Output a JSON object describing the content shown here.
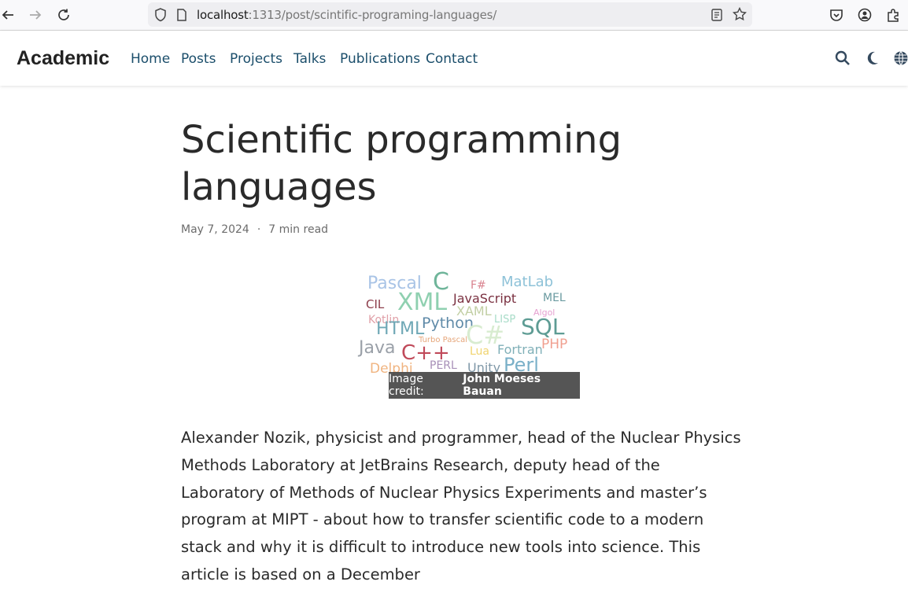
{
  "browser": {
    "url_host": "localhost",
    "url_path": ":1313/post/scintific-programing-languages/"
  },
  "site": {
    "brand": "Academic",
    "menu": [
      "Home",
      "Posts",
      "Projects",
      "Talks",
      "Publications",
      "Contact"
    ]
  },
  "post": {
    "title": "Scientific programming languages",
    "date": "May 7, 2024",
    "separator": "·",
    "read_time": "7 min read",
    "image_credit_prefix": "Image credit:",
    "image_credit_author": "John Moeses Bauan",
    "wordcloud": [
      {
        "text": "Pascal",
        "color": "#a9c4e6"
      },
      {
        "text": "C",
        "color": "#6fb59a"
      },
      {
        "text": "F#",
        "color": "#d9838f"
      },
      {
        "text": "MatLab",
        "color": "#8ec2d8"
      },
      {
        "text": "CIL",
        "color": "#8c3c4a"
      },
      {
        "text": "XML",
        "color": "#8fd0b0"
      },
      {
        "text": "JavaScript",
        "color": "#7a3040"
      },
      {
        "text": "MEL",
        "color": "#6a9aa0"
      },
      {
        "text": "XAML",
        "color": "#c2cfa4"
      },
      {
        "text": "Algol",
        "color": "#e6a0d0"
      },
      {
        "text": "Kotlin",
        "color": "#e0a0a8"
      },
      {
        "text": "Python",
        "color": "#5f8aa8"
      },
      {
        "text": "LISP",
        "color": "#a8dcc8"
      },
      {
        "text": "HTML",
        "color": "#6fa8b6"
      },
      {
        "text": "SQL",
        "color": "#5e9c94"
      },
      {
        "text": "C#",
        "color": "#d8ecd0"
      },
      {
        "text": "Java",
        "color": "#9aa0a8"
      },
      {
        "text": "Turbo Pascal",
        "color": "#e6a67a"
      },
      {
        "text": "C++",
        "color": "#c04a5a"
      },
      {
        "text": "PHP",
        "color": "#f0a090"
      },
      {
        "text": "Fortran",
        "color": "#80b0b8"
      },
      {
        "text": "Lua",
        "color": "#f0d470"
      },
      {
        "text": "Delphi",
        "color": "#f0b480"
      },
      {
        "text": "PERL",
        "color": "#a890b8"
      },
      {
        "text": "Unity",
        "color": "#8098a8"
      },
      {
        "text": "Perl",
        "color": "#7ab0c8"
      }
    ],
    "intro": "Alexander Nozik, physicist and programmer, head of the Nuclear Physics Methods Laboratory at JetBrains Research, deputy head of the Laboratory of Methods of Nuclear Physics Experiments and master’s program at MIPT - about how to transfer scientific code to a modern stack and why it is difficult to introduce new tools into science. This article is based on a December"
  },
  "icons": {
    "back": "arrow-left-icon",
    "forward": "arrow-right-icon",
    "reload": "reload-icon",
    "shield": "shield-icon",
    "page": "page-icon",
    "reader": "reader-view-icon",
    "bookmark": "star-icon",
    "pocket": "pocket-icon",
    "account": "account-icon",
    "extensions": "extensions-icon",
    "search": "search-icon",
    "theme": "moon-icon",
    "language": "globe-icon"
  }
}
